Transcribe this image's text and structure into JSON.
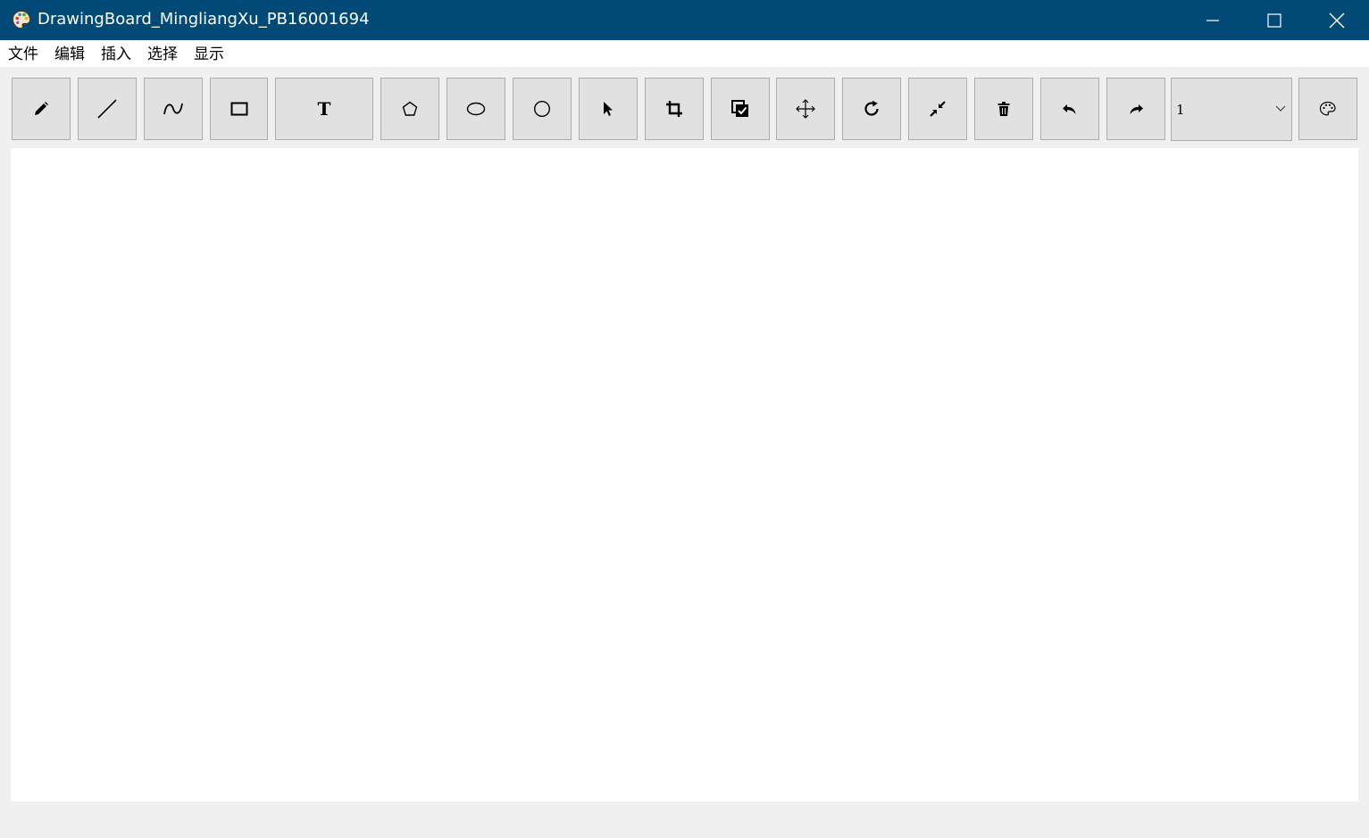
{
  "window": {
    "title": "DrawingBoard_MingliangXu_PB16001694",
    "icon": "palette-icon",
    "controls": [
      "minimize-icon",
      "maximize-icon",
      "close-icon"
    ]
  },
  "menu": {
    "file": "文件",
    "edit": "编辑",
    "insert": "插入",
    "select": "选择",
    "display": "显示"
  },
  "toolbar": {
    "tools": [
      {
        "name": "pencil",
        "icon": "pencil-icon"
      },
      {
        "name": "line",
        "icon": "line-icon"
      },
      {
        "name": "curve",
        "icon": "curve-icon"
      },
      {
        "name": "rectangle",
        "icon": "rectangle-icon"
      },
      {
        "name": "text",
        "icon": "text-icon",
        "label": "T"
      },
      {
        "name": "polygon",
        "icon": "pentagon-icon"
      },
      {
        "name": "ellipse",
        "icon": "ellipse-icon"
      },
      {
        "name": "circle",
        "icon": "circle-icon"
      },
      {
        "name": "select",
        "icon": "cursor-icon"
      },
      {
        "name": "crop",
        "icon": "crop-icon"
      },
      {
        "name": "select-all",
        "icon": "select-all-icon"
      },
      {
        "name": "move",
        "icon": "move-icon"
      },
      {
        "name": "rotate",
        "icon": "rotate-icon"
      },
      {
        "name": "scale",
        "icon": "shrink-icon"
      },
      {
        "name": "delete",
        "icon": "trash-icon"
      },
      {
        "name": "undo",
        "icon": "undo-icon"
      },
      {
        "name": "redo",
        "icon": "redo-icon"
      }
    ],
    "line_width": {
      "value": "1"
    },
    "color_button": {
      "icon": "palette-icon"
    }
  },
  "colors": {
    "titlebar": "#014a78",
    "button_face": "#e1e1e1",
    "button_border": "#adadad",
    "canvas": "#ffffff",
    "background": "#f0f0f0"
  }
}
